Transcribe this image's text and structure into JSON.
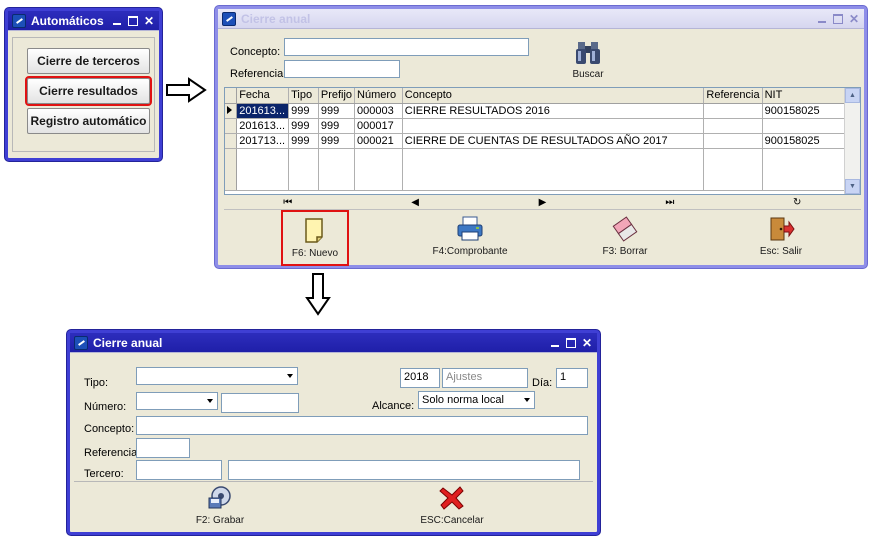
{
  "auto_window": {
    "title": "Automáticos",
    "buttons": [
      "Cierre de terceros",
      "Cierre resultados",
      "Registro automático"
    ]
  },
  "cierre_window": {
    "title": "Cierre anual",
    "concepto_label": "Concepto:",
    "referencia_label": "Referencia:",
    "concepto_value": "",
    "referencia_value": "",
    "buscar_label": "Buscar",
    "columns": [
      "Fecha",
      "Tipo",
      "Prefijo",
      "Número",
      "Concepto",
      "Referencia",
      "NIT"
    ],
    "rows": [
      [
        "201613...",
        "999",
        "999",
        "000003",
        "CIERRE RESULTADOS 2016",
        "",
        "900158025"
      ],
      [
        "201613...",
        "999",
        "999",
        "000017",
        "",
        "",
        ""
      ],
      [
        "201713...",
        "999",
        "999",
        "000021",
        "CIERRE DE CUENTAS DE RESULTADOS AÑO 2017",
        "",
        "900158025"
      ]
    ],
    "nav": [
      "⏮",
      "◀",
      "▶",
      "⏭",
      "↻"
    ],
    "actions": {
      "nuevo": "F6: Nuevo",
      "comprobante": "F4:Comprobante",
      "borrar": "F3: Borrar",
      "salir": "Esc: Salir"
    }
  },
  "new_window": {
    "title": "Cierre anual",
    "tipo_label": "Tipo:",
    "numero_label": "Número:",
    "concepto_label": "Concepto:",
    "referencia_label": "Referencia:",
    "tercero_label": "Tercero:",
    "year_value": "2018",
    "ajustes_placeholder": "Ajustes",
    "dia_label": "Día:",
    "dia_value": "1",
    "alcance_label": "Alcance:",
    "alcance_value": "Solo norma local",
    "grabar_label": "F2: Grabar",
    "cancelar_label": "ESC:Cancelar"
  },
  "colors": {
    "window_border": "#3f3fd4",
    "highlight": "#e01212",
    "selected_row": "#0a246a"
  }
}
